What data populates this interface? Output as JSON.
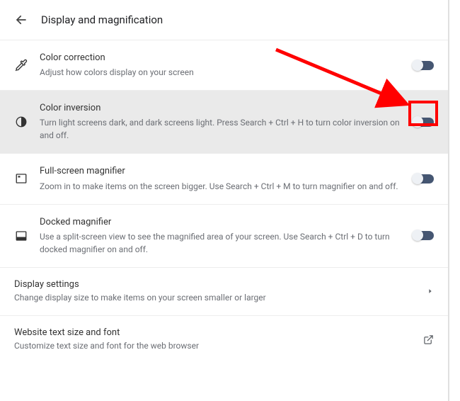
{
  "header": {
    "title": "Display and magnification"
  },
  "rows": {
    "color_correction": {
      "title": "Color correction",
      "desc": "Adjust how colors display on your screen"
    },
    "color_inversion": {
      "title": "Color inversion",
      "desc": "Turn light screens dark, and dark screens light. Press Search + Ctrl + H to turn color inversion on and off."
    },
    "fullscreen_magnifier": {
      "title": "Full-screen magnifier",
      "desc": "Zoom in to make items on the screen bigger. Use Search + Ctrl + M to turn magnifier on and off."
    },
    "docked_magnifier": {
      "title": "Docked magnifier",
      "desc": "Use a split-screen view to see the magnified area of your screen. Use Search + Ctrl + D to turn docked magnifier on and off."
    }
  },
  "links": {
    "display_settings": {
      "title": "Display settings",
      "desc": "Change display size to make items on your screen smaller or larger"
    },
    "website_text": {
      "title": "Website text size and font",
      "desc": "Customize text size and font for the web browser"
    }
  },
  "annotation": {
    "highlight_color": "#ff0000"
  }
}
